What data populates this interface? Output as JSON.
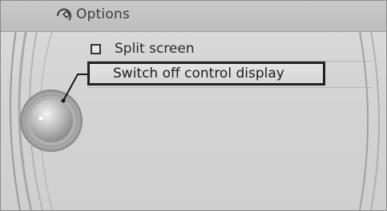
{
  "header": {
    "title": "Options",
    "icon": "settings-display-icon"
  },
  "menu": {
    "items": [
      {
        "label": "Split screen",
        "has_checkbox": true,
        "checked": false,
        "selected": false
      },
      {
        "label": "Switch off control display",
        "has_checkbox": false,
        "selected": true
      }
    ]
  },
  "controller": {
    "icon": "controller-knob-icon"
  },
  "colors": {
    "background": "#d4d4d4",
    "header": "#c3c3c3",
    "selection_border": "#222222",
    "text": "#2a2a2a"
  }
}
